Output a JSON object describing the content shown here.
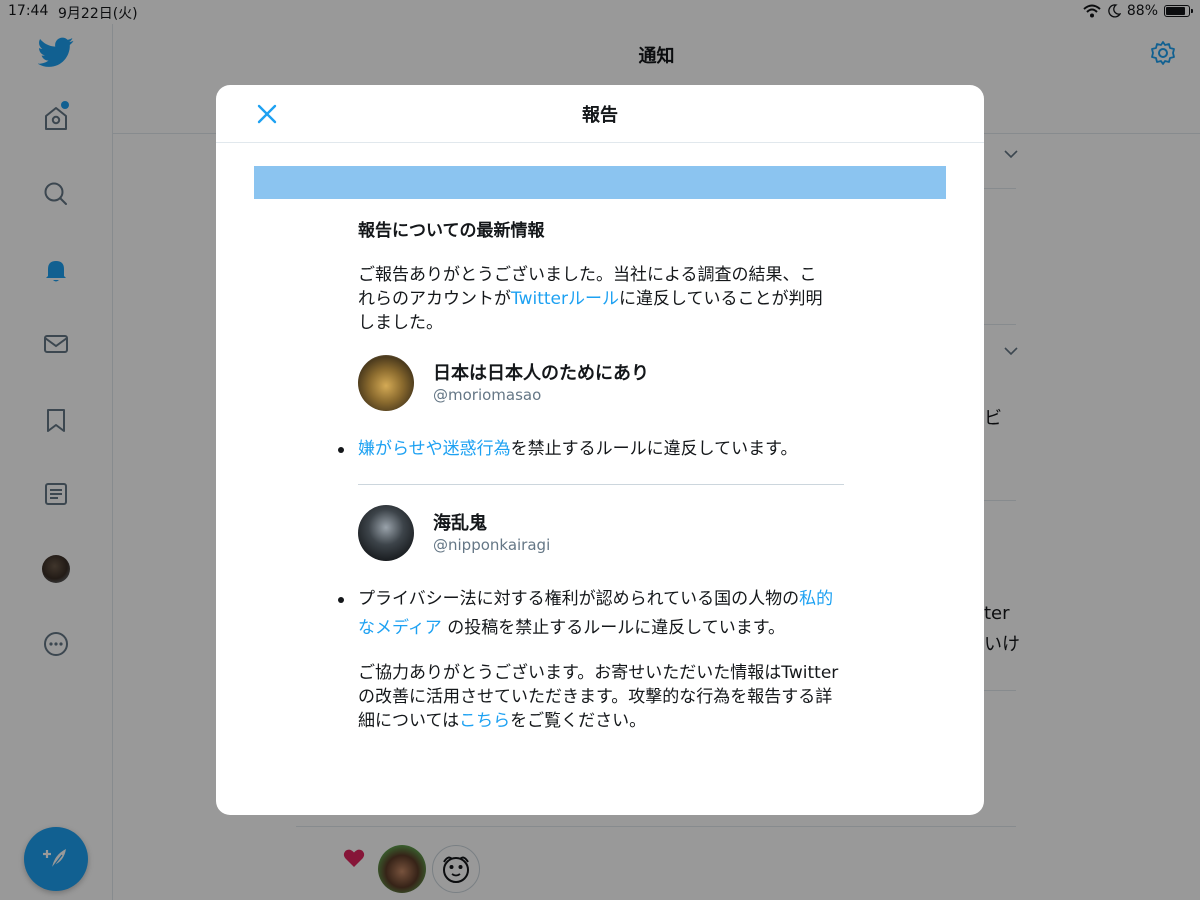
{
  "status_bar": {
    "time": "17:44",
    "date": "9月22日(火)",
    "battery": "88%"
  },
  "header": {
    "title": "通知"
  },
  "background": {
    "fragment_1": "ビ",
    "fragment_2": "ter",
    "fragment_3": "いけ"
  },
  "modal": {
    "title": "報告",
    "section_title": "報告についての最新情報",
    "intro_pre": "ご報告ありがとうございました。当社による調査の結果、これらのアカウントが",
    "intro_link": "Twitterルール",
    "intro_post": "に違反していることが判明しました。",
    "accounts": [
      {
        "name": "日本は日本人のためにあり",
        "handle": "@moriomasao",
        "reason_link": "嫌がらせや迷惑行為",
        "reason_post": "を禁止するルールに違反しています。"
      },
      {
        "name": "海乱鬼",
        "handle": "@nipponkairagi",
        "reason_pre": "プライバシー法に対する権利が認められている国の人物の",
        "reason_link": "私的なメディア",
        "reason_post": " の投稿を禁止するルールに違反しています。"
      }
    ],
    "thanks_pre": "ご協力ありがとうございます。お寄せいただいた情報はTwitterの改善に活用させていただきます。攻撃的な行為を報告する詳細については",
    "thanks_link": "こちら",
    "thanks_post": "をご覧ください。"
  },
  "icons": {
    "logo": "twitter-bird-icon",
    "nav": [
      "home-icon",
      "search-icon",
      "notifications-bell-icon",
      "messages-icon",
      "bookmark-icon",
      "lists-icon",
      "profile-avatar",
      "more-icon"
    ],
    "compose": "compose-tweet-icon",
    "settings": "gear-icon",
    "close": "close-icon"
  },
  "colors": {
    "accent": "#1da1f2",
    "banner": "#8bc4f0",
    "secondary_text": "#657786"
  }
}
